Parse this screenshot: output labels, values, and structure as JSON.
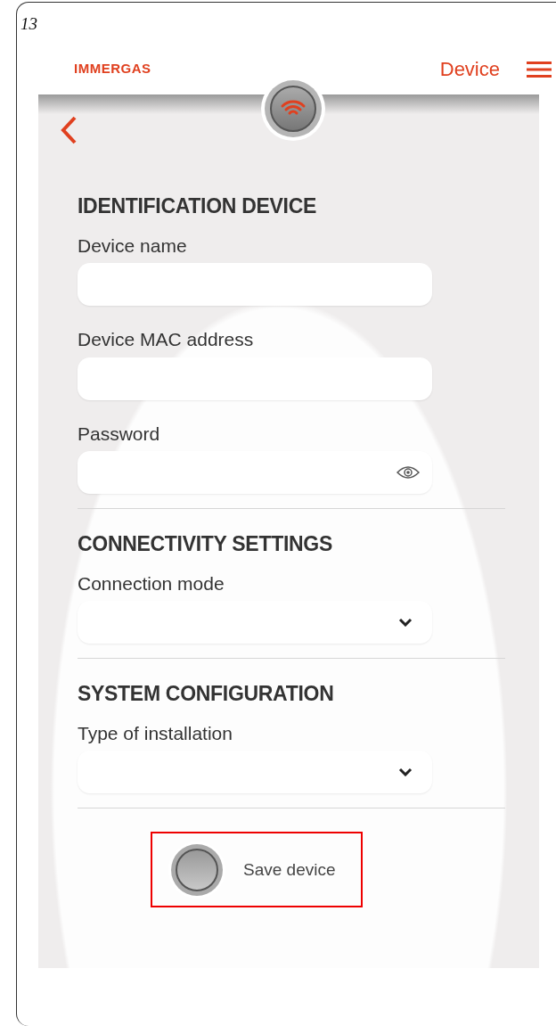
{
  "page_number": "13",
  "header": {
    "brand": "IMMERGAS",
    "title": "Device"
  },
  "sections": [
    {
      "heading": "IDENTIFICATION DEVICE",
      "fields": [
        {
          "label": "Device name",
          "kind": "text"
        },
        {
          "label": "Device MAC address",
          "kind": "text"
        },
        {
          "label": "Password",
          "kind": "password"
        }
      ]
    },
    {
      "heading": "CONNECTIVITY SETTINGS",
      "fields": [
        {
          "label": "Connection mode",
          "kind": "select"
        }
      ]
    },
    {
      "heading": "SYSTEM CONFIGURATION",
      "fields": [
        {
          "label": "Type of installation",
          "kind": "select"
        }
      ]
    }
  ],
  "save_button": {
    "label": "Save device",
    "highlighted": true
  }
}
